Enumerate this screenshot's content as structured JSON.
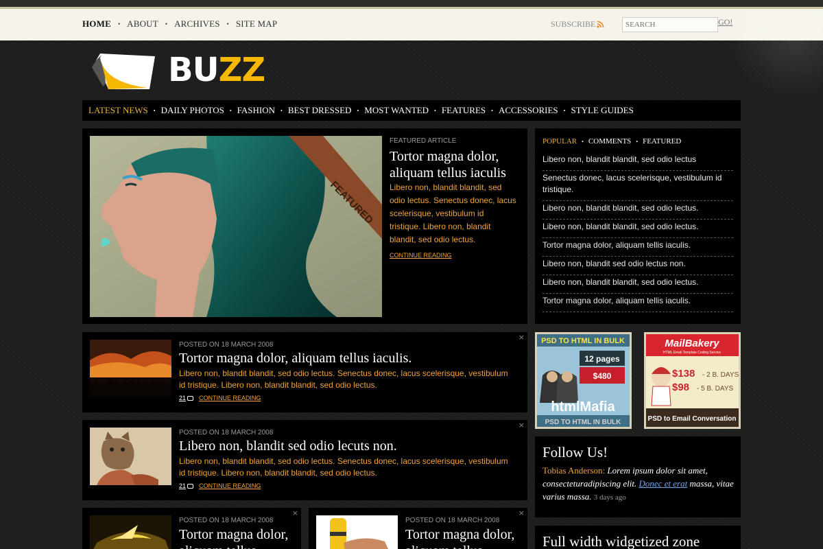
{
  "topnav": {
    "items": [
      {
        "label": "HOME",
        "active": true
      },
      {
        "label": "ABOUT"
      },
      {
        "label": "ARCHIVES"
      },
      {
        "label": "SITE MAP"
      }
    ],
    "subscribe": "SUBSCRIBE",
    "search_placeholder": "SEARCH",
    "search_button": "GO!"
  },
  "logo": {
    "text_white": "BU",
    "text_yellow": "ZZ"
  },
  "mainnav": {
    "items": [
      {
        "label": "LATEST NEWS",
        "active": true
      },
      {
        "label": "DAILY PHOTOS"
      },
      {
        "label": "FASHION"
      },
      {
        "label": "BEST DRESSED"
      },
      {
        "label": "MOST WANTED"
      },
      {
        "label": "FEATURES"
      },
      {
        "label": "ACCESSORIES"
      },
      {
        "label": "STYLE GUIDES"
      }
    ]
  },
  "featured": {
    "ribbon": "FEATURED",
    "meta": "FEATURED ARTICLE",
    "title": "Tortor magna dolor, aliquam tellus iaculis",
    "body": "Libero non, blandit blandit, sed odio lectus. Senectus donec, lacus scelerisque, vestibulum id tristique. Libero non, blandit blandit, sed odio lectus.",
    "more": "CONTINUE READING"
  },
  "posts": [
    {
      "meta": "POSTED ON 18 MARCH 2008",
      "title": "Tortor magna dolor, aliquam tellus iaculis.",
      "body": "Libero non, blandit blandit, sed odio lectus. Senectus donec, lacus scelerisque, vestibulum id tristique. Libero non, blandit blandit, sed odio lectus.",
      "comments": "21",
      "more": "CONTINUE READING",
      "close": "×"
    },
    {
      "meta": "POSTED ON 18 MARCH 2008",
      "title": "Libero non, blandit sed odio lecuts non.",
      "body": "Libero non, blandit blandit, sed odio lectus. Senectus donec, lacus scelerisque, vestibulum id tristique. Libero non, blandit blandit, sed odio lectus.",
      "comments": "21",
      "more": "CONTINUE READING",
      "close": "×"
    }
  ],
  "half_posts": [
    {
      "meta": "POSTED ON 18 MARCH 2008",
      "title": "Tortor magna dolor, aliquam tellus",
      "close": "×"
    },
    {
      "meta": "POSTED ON 18 MARCH 2008",
      "title": "Tortor magna dolor, aliquam tellus",
      "close": "×"
    }
  ],
  "sidebar": {
    "tabs": [
      {
        "label": "POPULAR",
        "active": true
      },
      {
        "label": "COMMENTS"
      },
      {
        "label": "FEATURED"
      }
    ],
    "items": [
      "Libero non, blandit blandit, sed odio lectus",
      "Senectus donec, lacus scelerisque, vestibulum id tristique.",
      "Libero non, blandit blandit, sed odio lectus.",
      "Libero non, blandit blandit, sed odio lectus.",
      "Tortor magna dolor, aliquam tellis iaculis.",
      "Libero non, blandit sed odio lectus non.",
      "Libero non, blandit blandit, sed odio lectus.",
      "Tortor magna dolor, aliquam tellis iaculis."
    ]
  },
  "ads": {
    "ad1": {
      "top": "PSD TO HTML IN BULK",
      "pages": "12 pages",
      "price": "$480",
      "brand": "htmlMafia",
      "bottom": "PSD TO HTML IN BULK"
    },
    "ad2": {
      "brand": "MailBakery",
      "tagline": "HTML Email Template Coding Service",
      "price1": "$138",
      "days1": "- 2 B. DAYS",
      "price2": "$98",
      "days2": "- 5 B. DAYS",
      "bottom": "PSD to Email Conversation"
    }
  },
  "follow": {
    "title": "Follow Us!",
    "author": "Tobias Anderson:",
    "text1": "Lorem ipsum dolor sit amet, consecteturadipiscing elit.",
    "link": "Donec et erat",
    "text2": "massa, vitae varius massa.",
    "ago": "3 days ago"
  },
  "fullwidth": {
    "title": "Full width widgetized zone"
  },
  "colors": {
    "accent_orange": "#f0a338",
    "accent_gold": "#e8b43a",
    "logo_yellow": "#f5b700"
  }
}
